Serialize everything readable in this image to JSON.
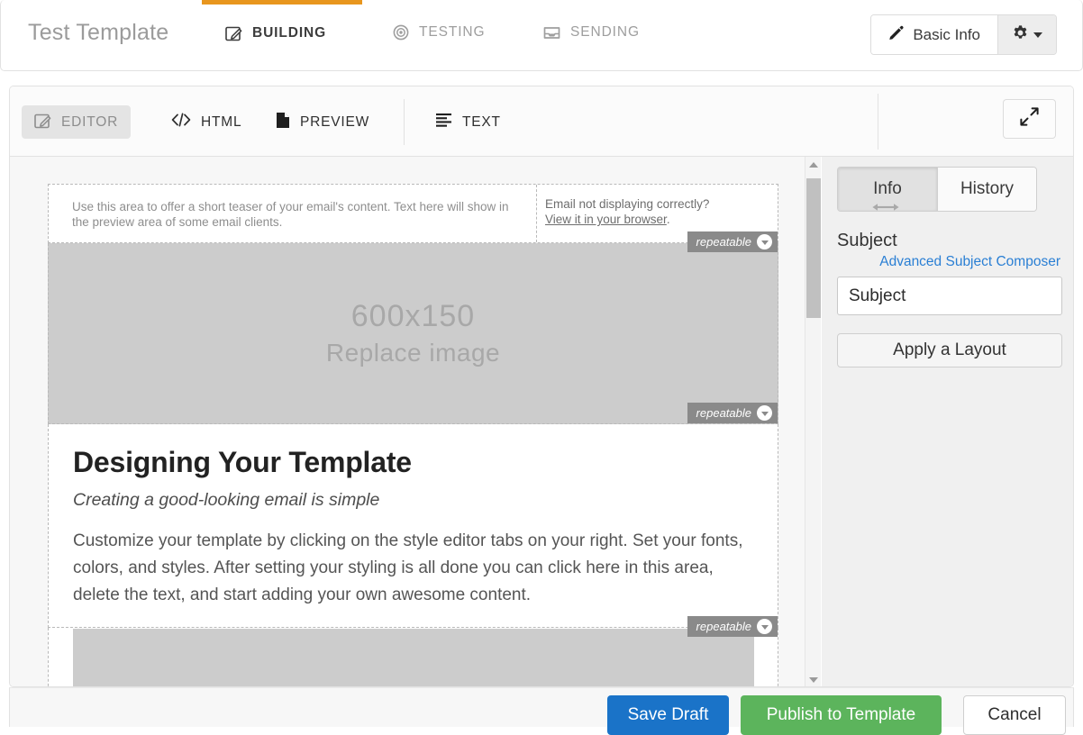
{
  "header": {
    "template_title": "Test Template",
    "mode_tabs": [
      {
        "label": "BUILDING",
        "icon": "pencil-square-icon",
        "active": true
      },
      {
        "label": "TESTING",
        "icon": "target-icon",
        "active": false
      },
      {
        "label": "SENDING",
        "icon": "inbox-icon",
        "active": false
      }
    ],
    "basic_info_label": "Basic Info",
    "basic_info_icon": "pencil-icon",
    "gear_icon": "gear-icon",
    "active_indicator_color": "#e8961e"
  },
  "toolbar": {
    "view_tabs": [
      {
        "label": "EDITOR",
        "icon": "pencil-square-icon",
        "active": true
      },
      {
        "label": "HTML",
        "icon": "code-icon",
        "active": false
      },
      {
        "label": "PREVIEW",
        "icon": "document-icon",
        "active": false
      },
      {
        "label": "TEXT",
        "icon": "text-lines-icon",
        "active": false
      }
    ],
    "resize_icon": "horizontal-resize-icon",
    "expand_icon": "expand-diagonal-icon"
  },
  "email": {
    "preheader_text": "Use this area to offer a short teaser of your email's content. Text here will show in the preview area of some email clients.",
    "not_displaying_text": "Email not displaying correctly?",
    "browser_link_text": "View it in your browser",
    "browser_link_suffix": ".",
    "hero_image": {
      "size_label": "600x150",
      "replace_label": "Replace image"
    },
    "heading": "Designing Your Template",
    "subheading": "Creating a good-looking email is simple",
    "body": "Customize your template by clicking on the style editor tabs on your right. Set your fonts, colors, and styles. After setting your styling is all done you can click here in this area, delete the text, and start adding your own awesome content.",
    "repeatable_badge_label": "repeatable",
    "repeatable_badge_icon": "chevron-down-circle-icon"
  },
  "sidebar": {
    "tabs": [
      {
        "label": "Info",
        "active": true
      },
      {
        "label": "History",
        "active": false
      }
    ],
    "subject_label": "Subject",
    "advanced_composer_link": "Advanced Subject Composer",
    "advanced_composer_color": "#2a7fd4",
    "subject_placeholder": "Subject",
    "subject_value": "",
    "apply_layout_label": "Apply a Layout"
  },
  "actions": {
    "save_draft_label": "Save Draft",
    "save_draft_color": "#1a73c8",
    "publish_label": "Publish to Template",
    "publish_color": "#5cb45c",
    "cancel_label": "Cancel"
  },
  "scrollbar": {
    "up_icon": "triangle-up-icon",
    "down_icon": "triangle-down-icon"
  }
}
